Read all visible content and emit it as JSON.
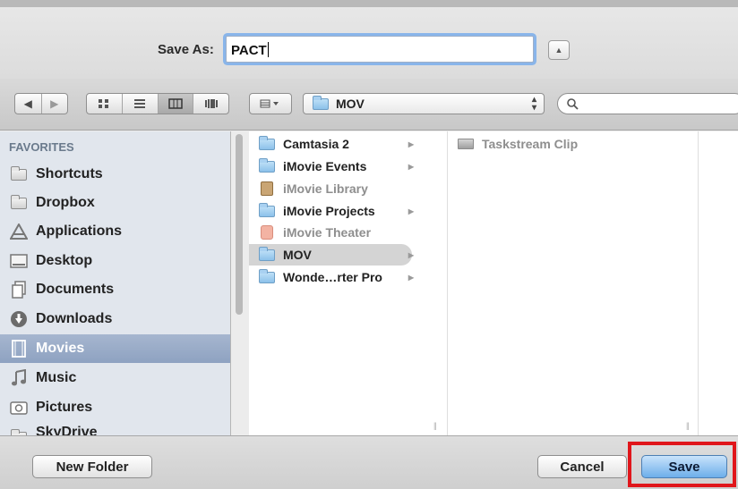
{
  "save_as": {
    "label": "Save As:",
    "value": "PACT"
  },
  "toolbar": {
    "back_icon": "◀",
    "forward_icon": "▶",
    "view_icons": [
      "icon-view",
      "list-view",
      "column-view",
      "coverflow-view"
    ],
    "arrange_icon": "arrange-icon",
    "path_label": "MOV",
    "search_placeholder": ""
  },
  "sidebar": {
    "heading": "FAVORITES",
    "items": [
      {
        "label": "Shortcuts",
        "icon": "folder-icon"
      },
      {
        "label": "Dropbox",
        "icon": "folder-icon"
      },
      {
        "label": "Applications",
        "icon": "applications-icon"
      },
      {
        "label": "Desktop",
        "icon": "desktop-icon"
      },
      {
        "label": "Documents",
        "icon": "documents-icon"
      },
      {
        "label": "Downloads",
        "icon": "downloads-icon"
      },
      {
        "label": "Movies",
        "icon": "movies-icon",
        "selected": true
      },
      {
        "label": "Music",
        "icon": "music-icon"
      },
      {
        "label": "Pictures",
        "icon": "pictures-icon"
      },
      {
        "label": "SkyDrive",
        "icon": "folder-icon"
      }
    ]
  },
  "column1": {
    "items": [
      {
        "label": "Camtasia 2",
        "type": "folder",
        "arrow": true
      },
      {
        "label": "iMovie Events",
        "type": "folder",
        "arrow": true
      },
      {
        "label": "iMovie Library",
        "type": "package",
        "dim": true
      },
      {
        "label": "iMovie Projects",
        "type": "folder",
        "arrow": true
      },
      {
        "label": "iMovie Theater",
        "type": "theater",
        "dim": true
      },
      {
        "label": "MOV",
        "type": "folder",
        "arrow": true,
        "selected": true
      },
      {
        "label": "Wonde…rter Pro",
        "type": "folder",
        "arrow": true
      }
    ]
  },
  "column2": {
    "items": [
      {
        "label": "Taskstream Clip",
        "type": "clip",
        "dim": true
      }
    ]
  },
  "buttons": {
    "new_folder": "New Folder",
    "cancel": "Cancel",
    "save": "Save"
  },
  "colors": {
    "save_highlight": "#e0161b",
    "focus_ring": "#89b5ea",
    "sidebar_selected": "#97a9c6"
  }
}
